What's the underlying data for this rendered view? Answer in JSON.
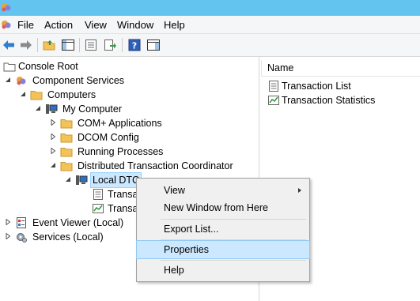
{
  "window": {
    "icon": "component-services-icon"
  },
  "menu": {
    "items": [
      "File",
      "Action",
      "View",
      "Window",
      "Help"
    ]
  },
  "toolbar": {
    "buttons": [
      "back-arrow-icon",
      "forward-arrow-icon",
      "up-folder-icon",
      "show-hide-tree-icon",
      "properties-icon",
      "export-list-icon",
      "help-icon",
      "show-hide-action-pane-icon"
    ]
  },
  "tree": {
    "nodes": [
      {
        "label": "Console Root",
        "icon": "folder-icon"
      },
      {
        "label": "Component Services",
        "icon": "component-services-icon"
      },
      {
        "label": "Computers",
        "icon": "folder-icon"
      },
      {
        "label": "My Computer",
        "icon": "computer-icon"
      },
      {
        "label": "COM+ Applications",
        "icon": "folder-icon"
      },
      {
        "label": "DCOM Config",
        "icon": "folder-icon"
      },
      {
        "label": "Running Processes",
        "icon": "folder-icon"
      },
      {
        "label": "Distributed Transaction Coordinator",
        "icon": "folder-icon"
      },
      {
        "label": "Local DTC",
        "icon": "computer-icon"
      },
      {
        "label": "Transa",
        "icon": "list-icon"
      },
      {
        "label": "Transa",
        "icon": "statistics-icon"
      },
      {
        "label": "Event Viewer (Local)",
        "icon": "event-viewer-icon"
      },
      {
        "label": "Services (Local)",
        "icon": "gear-icon"
      }
    ]
  },
  "list": {
    "column": "Name",
    "items": [
      {
        "label": "Transaction List",
        "icon": "list-icon"
      },
      {
        "label": "Transaction Statistics",
        "icon": "statistics-icon"
      }
    ]
  },
  "context_menu": {
    "items": [
      "View",
      "New Window from Here",
      "Export List...",
      "Properties",
      "Help"
    ],
    "highlighted": "Properties"
  },
  "colors": {
    "titlebar": "#63c4ef",
    "selection": "#cce8ff",
    "folder": "#f3c35a"
  }
}
